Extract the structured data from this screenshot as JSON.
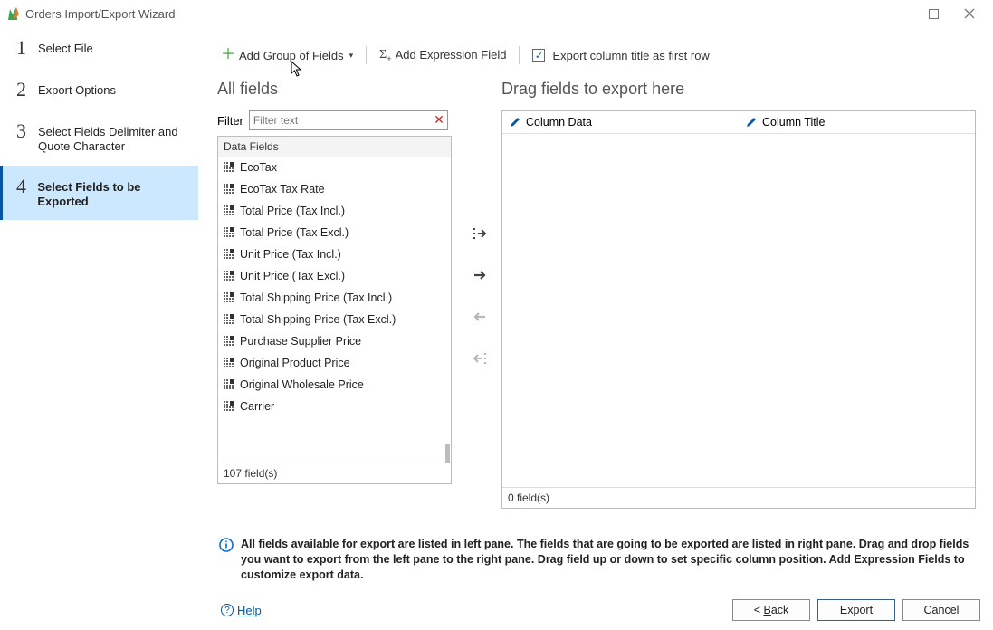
{
  "window": {
    "title": "Orders Import/Export Wizard"
  },
  "steps": [
    {
      "num": "1",
      "label": "Select File"
    },
    {
      "num": "2",
      "label": "Export Options"
    },
    {
      "num": "3",
      "label": "Select Fields Delimiter and Quote Character"
    },
    {
      "num": "4",
      "label": "Select Fields to be Exported"
    }
  ],
  "toolbar": {
    "add_group": "Add Group of Fields",
    "add_expr": "Add Expression Field",
    "first_row": "Export column title as first row"
  },
  "left": {
    "heading": "All fields",
    "filter_label": "Filter",
    "filter_placeholder": "Filter text",
    "group_header": "Data Fields",
    "fields": [
      "EcoTax",
      "EcoTax Tax Rate",
      "Total Price (Tax Incl.)",
      "Total Price (Tax Excl.)",
      "Unit Price (Tax Incl.)",
      "Unit Price (Tax Excl.)",
      "Total Shipping Price (Tax Incl.)",
      "Total Shipping Price (Tax Excl.)",
      "Purchase Supplier Price",
      "Original Product Price",
      "Original Wholesale Price",
      "Carrier"
    ],
    "count_label": "107 field(s)"
  },
  "right": {
    "heading": "Drag fields to export here",
    "col1": "Column Data",
    "col2": "Column Title",
    "count_label": "0 field(s)"
  },
  "info": "All fields available for export are listed in left pane. The fields that are going to be exported are listed in right pane. Drag and drop fields you want to export from the left pane to the right pane. Drag field up or down to set specific column position. Add Expression Fields to customize export data.",
  "footer": {
    "help": "Help",
    "back": "< Back",
    "back_key": "B",
    "export": "Export",
    "cancel": "Cancel"
  }
}
